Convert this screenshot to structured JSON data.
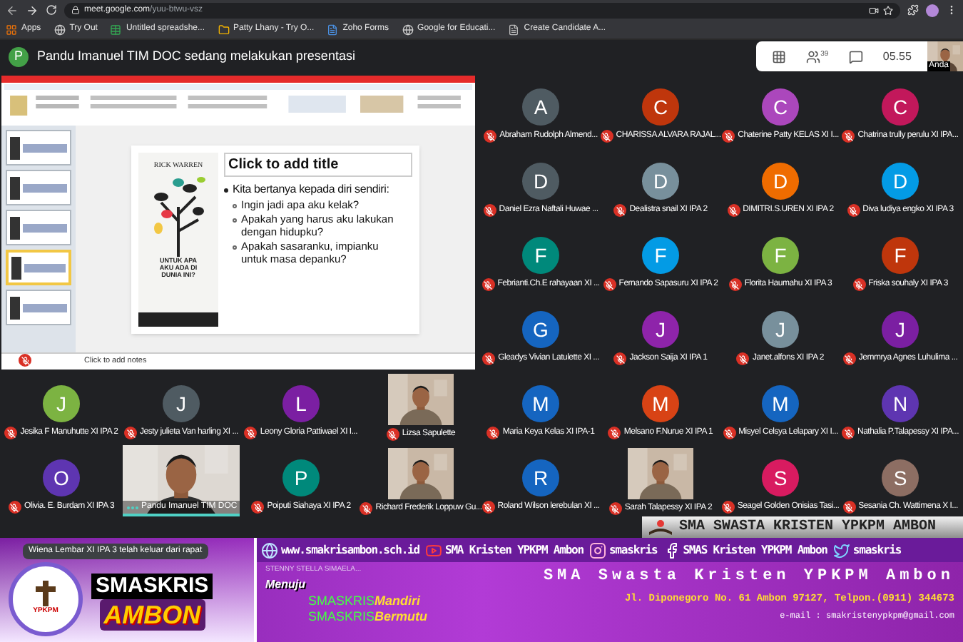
{
  "browser": {
    "url_host": "meet.google.com",
    "url_path": "/yuu-btwu-vsz"
  },
  "bookmarks": [
    {
      "kind": "apps",
      "label": "Apps"
    },
    {
      "kind": "globe",
      "label": "Try Out"
    },
    {
      "kind": "sheet",
      "label": "Untitled spreadshe..."
    },
    {
      "kind": "folder",
      "label": "Patty Lhany - Try O..."
    },
    {
      "kind": "zoho",
      "label": "Zoho Forms"
    },
    {
      "kind": "globe",
      "label": "Google for Educati..."
    },
    {
      "kind": "page",
      "label": "Create Candidate A..."
    }
  ],
  "meeting": {
    "presenter_initial": "P",
    "presenting_text": "Pandu Imanuel TIM DOC sedang melakukan presentasi",
    "participant_count": "39",
    "time": "05.55",
    "self_label": "Anda"
  },
  "presentation": {
    "slides": [
      {
        "selected": false
      },
      {
        "selected": false
      },
      {
        "selected": false
      },
      {
        "selected": true
      },
      {
        "selected": false
      }
    ],
    "title_placeholder": "Click to add title",
    "book_author": "RICK WARREN",
    "book_title": "UNTUK APA AKU ADA DI DUNIA INI?",
    "bullets": [
      {
        "text": "Kita bertanya kepada diri sendiri:",
        "children": [
          {
            "text": "Ingin jadi apa aku kelak?"
          },
          {
            "text": "Apakah yang harus aku lakukan dengan hidupku?"
          },
          {
            "text": "Apakah sasaranku, impianku untuk masa depanku?"
          }
        ]
      }
    ],
    "notes_placeholder": "Click to add notes"
  },
  "participants": [
    {
      "kind": "avatar",
      "initial": "A",
      "color": "#4f5b62",
      "name": "Abraham Rudolph Almend..."
    },
    {
      "kind": "avatar",
      "initial": "C",
      "color": "#bf360c",
      "name": "CHARISSA ALVARA RAJAL..."
    },
    {
      "kind": "avatar",
      "initial": "C",
      "color": "#ab47bc",
      "name": "Chaterine Patty KELAS XI I..."
    },
    {
      "kind": "avatar",
      "initial": "C",
      "color": "#c2185b",
      "name": "Chatrina trully perulu XI IPA..."
    },
    {
      "kind": "avatar",
      "initial": "D",
      "color": "#4f5b62",
      "name": "Daniel Ezra Naftali Huwae ..."
    },
    {
      "kind": "avatar",
      "initial": "D",
      "color": "#78909c",
      "name": "Dealistra snail XI IPA 2"
    },
    {
      "kind": "avatar",
      "initial": "D",
      "color": "#ef6c00",
      "name": "DIMITRI.S.UREN XI IPA 2"
    },
    {
      "kind": "avatar",
      "initial": "D",
      "color": "#039be5",
      "name": "Diva ludiya engko XI IPA 3"
    },
    {
      "kind": "avatar",
      "initial": "F",
      "color": "#00897b",
      "name": "Febrianti.Ch.E rahayaan XI ..."
    },
    {
      "kind": "avatar",
      "initial": "F",
      "color": "#039be5",
      "name": "Fernando Sapasuru XI IPA 2"
    },
    {
      "kind": "avatar",
      "initial": "F",
      "color": "#7cb342",
      "name": "Florita Haumahu XI IPA 3"
    },
    {
      "kind": "avatar",
      "initial": "F",
      "color": "#bf360c",
      "name": "Friska souhaly XI IPA 3"
    },
    {
      "kind": "avatar",
      "initial": "G",
      "color": "#1565c0",
      "name": "Gleadys Vivian Latulette XI ..."
    },
    {
      "kind": "avatar",
      "initial": "J",
      "color": "#8e24aa",
      "name": "Jackson Saija XI IPA 1"
    },
    {
      "kind": "avatar",
      "initial": "J",
      "color": "#78909c",
      "name": "Janet.alfons XI IPA 2"
    },
    {
      "kind": "avatar",
      "initial": "J",
      "color": "#7b1fa2",
      "name": "Jemmrya Agnes Luhulima ..."
    },
    {
      "kind": "avatar",
      "initial": "J",
      "color": "#7cb342",
      "name": "Jesika F Manuhutte XI IPA 2"
    },
    {
      "kind": "avatar",
      "initial": "J",
      "color": "#4f5b62",
      "name": "Jesty julieta Van harling XI ..."
    },
    {
      "kind": "avatar",
      "initial": "L",
      "color": "#7b1fa2",
      "name": "Leony Gloria Pattiwael XI I..."
    },
    {
      "kind": "video",
      "name": "Lizsa Sapulette"
    },
    {
      "kind": "avatar",
      "initial": "M",
      "color": "#1565c0",
      "name": "Maria Keya Kelas XI IPA-1"
    },
    {
      "kind": "avatar",
      "initial": "M",
      "color": "#d84315",
      "name": "Melsano F.Nurue XI IPA 1"
    },
    {
      "kind": "avatar",
      "initial": "M",
      "color": "#1565c0",
      "name": "Misyel Celsya Lelapary XI I..."
    },
    {
      "kind": "avatar",
      "initial": "N",
      "color": "#5e35b1",
      "name": "Nathalia P.Talapessy XI IPA..."
    },
    {
      "kind": "avatar",
      "initial": "O",
      "color": "#5e35b1",
      "name": "Olivia. E. Burdam XI IPA 3"
    },
    {
      "kind": "presenter",
      "name": "Pandu Imanuel TIM DOC"
    },
    {
      "kind": "avatar",
      "initial": "P",
      "color": "#00897b",
      "name": "Poiputi Siahaya XI IPA 2"
    },
    {
      "kind": "video",
      "name": "Richard Frederik Loppuw Gu..."
    },
    {
      "kind": "avatar",
      "initial": "R",
      "color": "#1565c0",
      "name": "Roland Wilson lerebulan XI ..."
    },
    {
      "kind": "video",
      "name": "Sarah Talapessy XI IPA 2"
    },
    {
      "kind": "avatar",
      "initial": "S",
      "color": "#d81b60",
      "name": "Seagel Golden Onisias Tasi..."
    },
    {
      "kind": "avatar",
      "initial": "S",
      "color": "#8d6e63",
      "name": "Sesania Ch. Wattimena X I..."
    }
  ],
  "notification": "Wiena Lembar XI IPA 3 telah keluar dari rapat",
  "partial_name": "STENNY STELLA SIMAELA...",
  "overlay": {
    "school_strip": "SMA SWASTA KRISTEN YPKPM AMBON",
    "logo_text": "YPKPM",
    "brand_top": "SMASKRIS",
    "brand_bottom": "AMBON",
    "links": [
      {
        "kind": "web",
        "label": "www.smakrisambon.sch.id"
      },
      {
        "kind": "youtube",
        "label": "SMA Kristen YPKPM Ambon"
      },
      {
        "kind": "instagram",
        "label": "smaskris"
      },
      {
        "kind": "facebook",
        "label": "SMAS Kristen YPKPM Ambon"
      },
      {
        "kind": "twitter",
        "label": "smaskris"
      }
    ],
    "menuju": "Menuju",
    "mottos": [
      {
        "brand": "SMASKRIS",
        "word": "Mandiri"
      },
      {
        "brand": "SMASKRIS",
        "word": "Bermutu"
      }
    ],
    "school_name": "SMA Swasta Kristen YPKPM Ambon",
    "address": "Jl. Diponegoro  No. 61 Ambon 97127, Telpon.(0911) 344673",
    "email": "e-mail : smakristenypkpm@gmail.com"
  }
}
